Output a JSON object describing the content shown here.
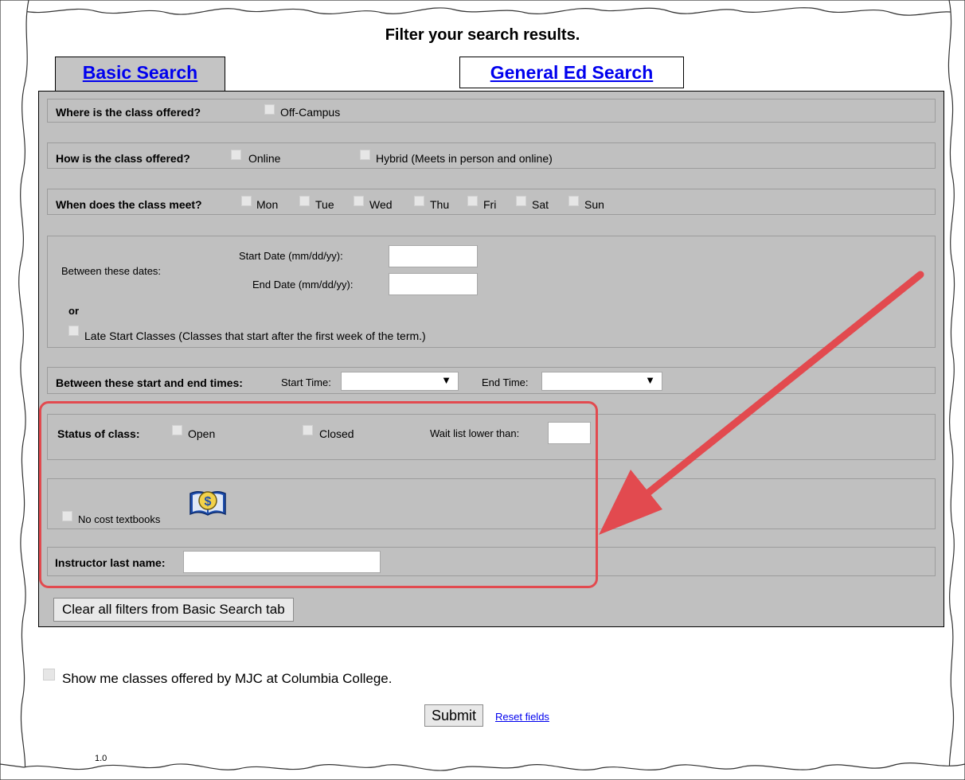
{
  "page": {
    "title": "Filter your search results.",
    "version": "1.0"
  },
  "tabs": {
    "basic": "Basic Search",
    "general_ed": "General Ed Search"
  },
  "location": {
    "label": "Where is the class offered?",
    "off_campus": "Off-Campus"
  },
  "mode": {
    "label": "How is the class offered?",
    "online": "Online",
    "hybrid": "Hybrid (Meets in person and online)"
  },
  "days": {
    "label": "When does the class meet?",
    "items": [
      "Mon",
      "Tue",
      "Wed",
      "Thu",
      "Fri",
      "Sat",
      "Sun"
    ]
  },
  "dates": {
    "label": "Between these dates:",
    "start_label": "Start Date (mm/dd/yy):",
    "start_value": "",
    "end_label": "End Date (mm/dd/yy):",
    "end_value": "",
    "or": "or",
    "late_start": "Late Start Classes (Classes that start after the first week of the term.)"
  },
  "times": {
    "label": "Between these start and end times:",
    "start_label": "Start Time:",
    "start_value": "",
    "end_label": "End Time:",
    "end_value": ""
  },
  "status": {
    "label": "Status of class:",
    "open": "Open",
    "closed": "Closed",
    "waitlist_label": "Wait list lower than:",
    "waitlist_value": ""
  },
  "textbooks": {
    "label": "No cost textbooks",
    "icon": "dollar-book-icon"
  },
  "instructor": {
    "label": "Instructor last name:",
    "value": ""
  },
  "buttons": {
    "clear": "Clear all filters from Basic Search tab",
    "submit": "Submit",
    "reset": "Reset fields"
  },
  "columbia": {
    "label": "Show me classes offered by MJC at Columbia College."
  },
  "colors": {
    "panel": "#c0c0c0",
    "highlight": "#e24a4f",
    "link": "#0000ee"
  }
}
